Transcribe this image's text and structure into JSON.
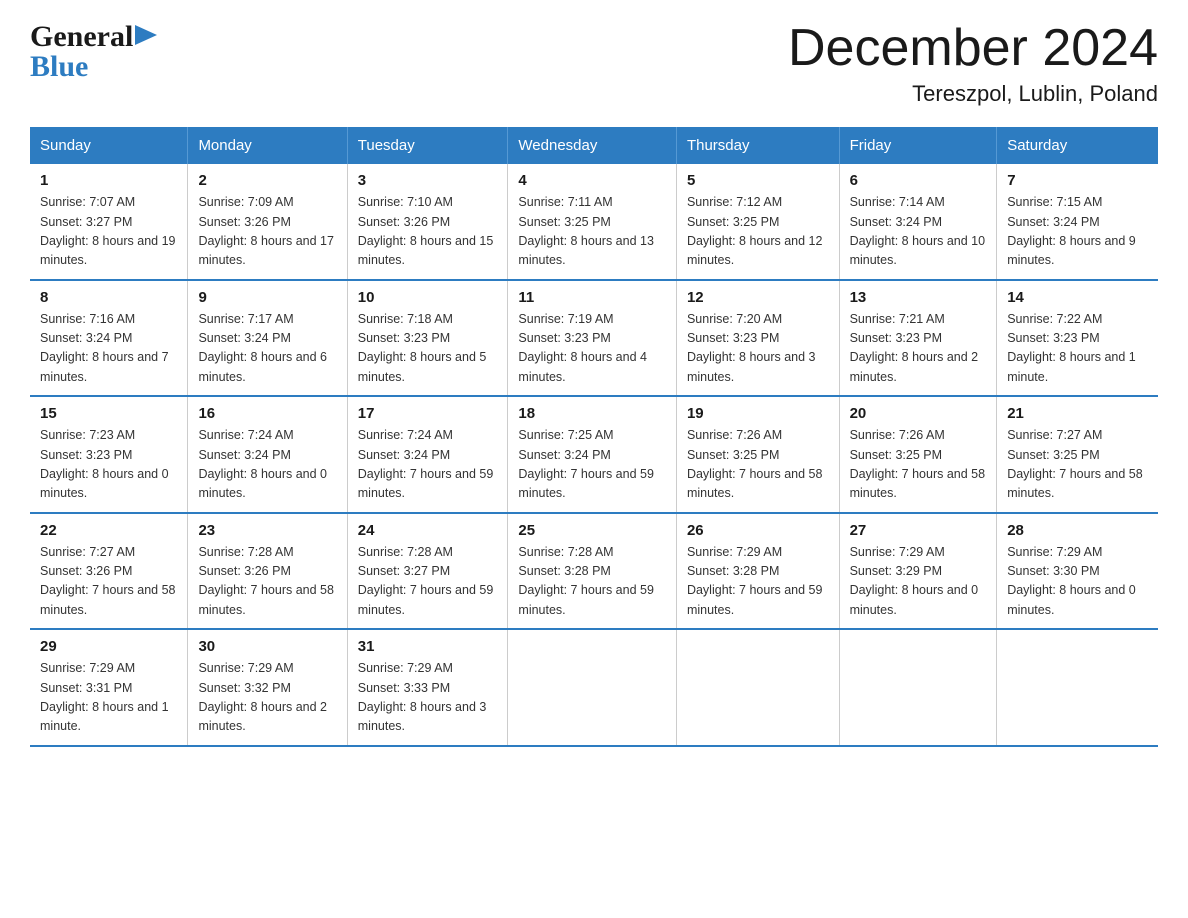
{
  "header": {
    "title": "December 2024",
    "subtitle": "Tereszpol, Lublin, Poland",
    "logo_general": "General",
    "logo_blue": "Blue"
  },
  "days_of_week": [
    "Sunday",
    "Monday",
    "Tuesday",
    "Wednesday",
    "Thursday",
    "Friday",
    "Saturday"
  ],
  "weeks": [
    [
      {
        "day": "1",
        "sunrise": "Sunrise: 7:07 AM",
        "sunset": "Sunset: 3:27 PM",
        "daylight": "Daylight: 8 hours and 19 minutes."
      },
      {
        "day": "2",
        "sunrise": "Sunrise: 7:09 AM",
        "sunset": "Sunset: 3:26 PM",
        "daylight": "Daylight: 8 hours and 17 minutes."
      },
      {
        "day": "3",
        "sunrise": "Sunrise: 7:10 AM",
        "sunset": "Sunset: 3:26 PM",
        "daylight": "Daylight: 8 hours and 15 minutes."
      },
      {
        "day": "4",
        "sunrise": "Sunrise: 7:11 AM",
        "sunset": "Sunset: 3:25 PM",
        "daylight": "Daylight: 8 hours and 13 minutes."
      },
      {
        "day": "5",
        "sunrise": "Sunrise: 7:12 AM",
        "sunset": "Sunset: 3:25 PM",
        "daylight": "Daylight: 8 hours and 12 minutes."
      },
      {
        "day": "6",
        "sunrise": "Sunrise: 7:14 AM",
        "sunset": "Sunset: 3:24 PM",
        "daylight": "Daylight: 8 hours and 10 minutes."
      },
      {
        "day": "7",
        "sunrise": "Sunrise: 7:15 AM",
        "sunset": "Sunset: 3:24 PM",
        "daylight": "Daylight: 8 hours and 9 minutes."
      }
    ],
    [
      {
        "day": "8",
        "sunrise": "Sunrise: 7:16 AM",
        "sunset": "Sunset: 3:24 PM",
        "daylight": "Daylight: 8 hours and 7 minutes."
      },
      {
        "day": "9",
        "sunrise": "Sunrise: 7:17 AM",
        "sunset": "Sunset: 3:24 PM",
        "daylight": "Daylight: 8 hours and 6 minutes."
      },
      {
        "day": "10",
        "sunrise": "Sunrise: 7:18 AM",
        "sunset": "Sunset: 3:23 PM",
        "daylight": "Daylight: 8 hours and 5 minutes."
      },
      {
        "day": "11",
        "sunrise": "Sunrise: 7:19 AM",
        "sunset": "Sunset: 3:23 PM",
        "daylight": "Daylight: 8 hours and 4 minutes."
      },
      {
        "day": "12",
        "sunrise": "Sunrise: 7:20 AM",
        "sunset": "Sunset: 3:23 PM",
        "daylight": "Daylight: 8 hours and 3 minutes."
      },
      {
        "day": "13",
        "sunrise": "Sunrise: 7:21 AM",
        "sunset": "Sunset: 3:23 PM",
        "daylight": "Daylight: 8 hours and 2 minutes."
      },
      {
        "day": "14",
        "sunrise": "Sunrise: 7:22 AM",
        "sunset": "Sunset: 3:23 PM",
        "daylight": "Daylight: 8 hours and 1 minute."
      }
    ],
    [
      {
        "day": "15",
        "sunrise": "Sunrise: 7:23 AM",
        "sunset": "Sunset: 3:23 PM",
        "daylight": "Daylight: 8 hours and 0 minutes."
      },
      {
        "day": "16",
        "sunrise": "Sunrise: 7:24 AM",
        "sunset": "Sunset: 3:24 PM",
        "daylight": "Daylight: 8 hours and 0 minutes."
      },
      {
        "day": "17",
        "sunrise": "Sunrise: 7:24 AM",
        "sunset": "Sunset: 3:24 PM",
        "daylight": "Daylight: 7 hours and 59 minutes."
      },
      {
        "day": "18",
        "sunrise": "Sunrise: 7:25 AM",
        "sunset": "Sunset: 3:24 PM",
        "daylight": "Daylight: 7 hours and 59 minutes."
      },
      {
        "day": "19",
        "sunrise": "Sunrise: 7:26 AM",
        "sunset": "Sunset: 3:25 PM",
        "daylight": "Daylight: 7 hours and 58 minutes."
      },
      {
        "day": "20",
        "sunrise": "Sunrise: 7:26 AM",
        "sunset": "Sunset: 3:25 PM",
        "daylight": "Daylight: 7 hours and 58 minutes."
      },
      {
        "day": "21",
        "sunrise": "Sunrise: 7:27 AM",
        "sunset": "Sunset: 3:25 PM",
        "daylight": "Daylight: 7 hours and 58 minutes."
      }
    ],
    [
      {
        "day": "22",
        "sunrise": "Sunrise: 7:27 AM",
        "sunset": "Sunset: 3:26 PM",
        "daylight": "Daylight: 7 hours and 58 minutes."
      },
      {
        "day": "23",
        "sunrise": "Sunrise: 7:28 AM",
        "sunset": "Sunset: 3:26 PM",
        "daylight": "Daylight: 7 hours and 58 minutes."
      },
      {
        "day": "24",
        "sunrise": "Sunrise: 7:28 AM",
        "sunset": "Sunset: 3:27 PM",
        "daylight": "Daylight: 7 hours and 59 minutes."
      },
      {
        "day": "25",
        "sunrise": "Sunrise: 7:28 AM",
        "sunset": "Sunset: 3:28 PM",
        "daylight": "Daylight: 7 hours and 59 minutes."
      },
      {
        "day": "26",
        "sunrise": "Sunrise: 7:29 AM",
        "sunset": "Sunset: 3:28 PM",
        "daylight": "Daylight: 7 hours and 59 minutes."
      },
      {
        "day": "27",
        "sunrise": "Sunrise: 7:29 AM",
        "sunset": "Sunset: 3:29 PM",
        "daylight": "Daylight: 8 hours and 0 minutes."
      },
      {
        "day": "28",
        "sunrise": "Sunrise: 7:29 AM",
        "sunset": "Sunset: 3:30 PM",
        "daylight": "Daylight: 8 hours and 0 minutes."
      }
    ],
    [
      {
        "day": "29",
        "sunrise": "Sunrise: 7:29 AM",
        "sunset": "Sunset: 3:31 PM",
        "daylight": "Daylight: 8 hours and 1 minute."
      },
      {
        "day": "30",
        "sunrise": "Sunrise: 7:29 AM",
        "sunset": "Sunset: 3:32 PM",
        "daylight": "Daylight: 8 hours and 2 minutes."
      },
      {
        "day": "31",
        "sunrise": "Sunrise: 7:29 AM",
        "sunset": "Sunset: 3:33 PM",
        "daylight": "Daylight: 8 hours and 3 minutes."
      },
      null,
      null,
      null,
      null
    ]
  ],
  "colors": {
    "header_bg": "#2d7cc1",
    "header_text": "#ffffff",
    "border": "#2d7cc1",
    "logo_blue": "#2d7cc1"
  }
}
